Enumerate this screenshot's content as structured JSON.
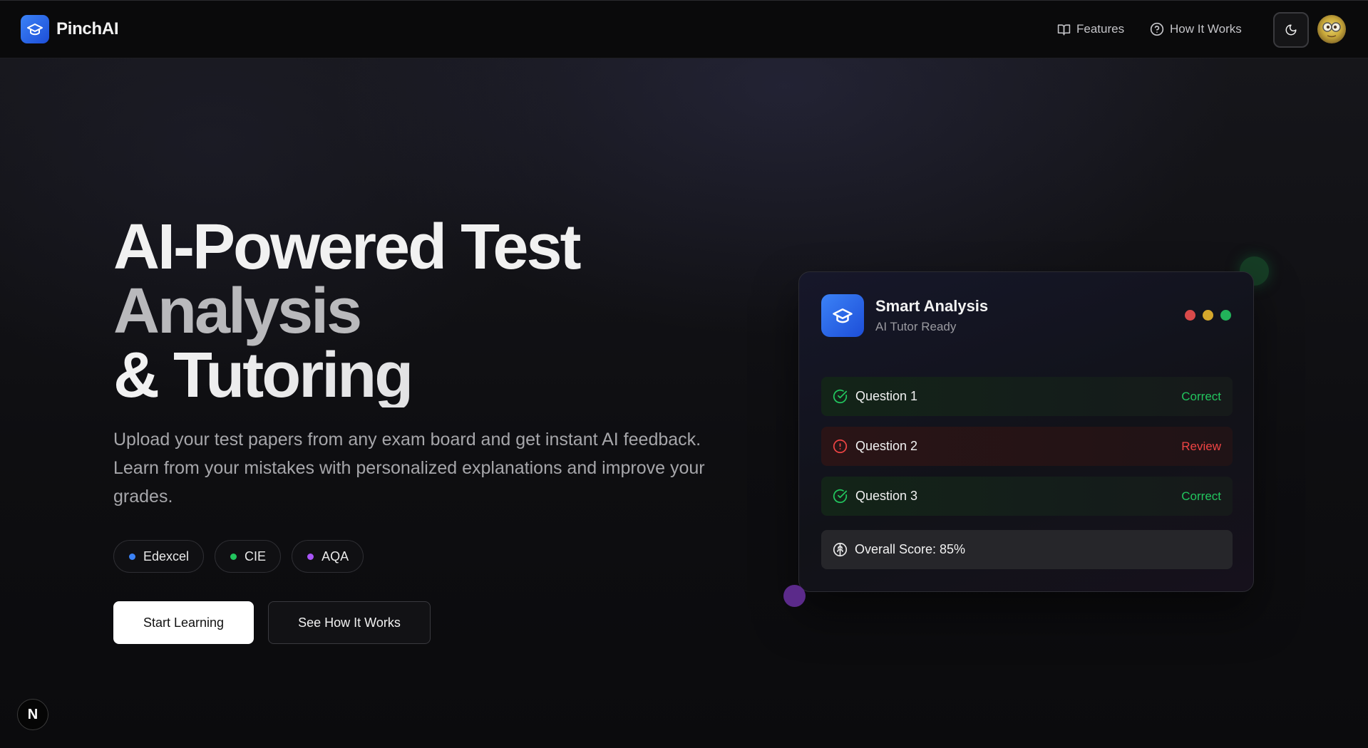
{
  "header": {
    "brand": "PinchAI",
    "nav": [
      {
        "label": "Features",
        "icon": "book-open-icon"
      },
      {
        "label": "How It Works",
        "icon": "help-circle-icon"
      }
    ],
    "theme_toggle_icon": "moon-icon"
  },
  "hero": {
    "title_line1": "AI-Powered Test",
    "title_line2": "Analysis",
    "title_line3": "& Tutoring",
    "subtitle": "Upload your test papers from any exam board and get instant AI feedback. Learn from your mistakes with personalized explanations and improve your grades.",
    "boards": [
      {
        "label": "Edexcel",
        "color": "#3b82f6"
      },
      {
        "label": "CIE",
        "color": "#22c55e"
      },
      {
        "label": "AQA",
        "color": "#a855f7"
      }
    ],
    "primary_cta": "Start Learning",
    "secondary_cta": "See How It Works"
  },
  "card": {
    "title": "Smart Analysis",
    "subtitle": "AI Tutor Ready",
    "window_dots": [
      "#ef4444",
      "#eab308",
      "#22c55e"
    ],
    "questions": [
      {
        "label": "Question 1",
        "status": "Correct",
        "state": "correct"
      },
      {
        "label": "Question 2",
        "status": "Review",
        "state": "review"
      },
      {
        "label": "Question 3",
        "status": "Correct",
        "state": "correct"
      }
    ],
    "score_label": "Overall Score: 85%"
  },
  "dev_badge": "N",
  "colors": {
    "accent_blue": "#3b82f6",
    "correct_green": "#22c55e",
    "review_red": "#ef4444"
  }
}
